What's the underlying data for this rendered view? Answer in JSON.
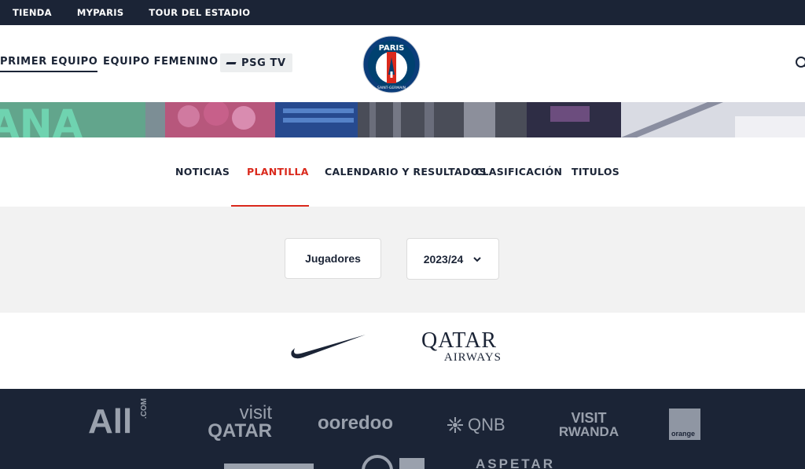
{
  "topbar": {
    "links": [
      "TIENDA",
      "MYPARIS",
      "TOUR DEL ESTADIO"
    ]
  },
  "mainnav": {
    "primer_equipo": "PRIMER EQUIPO",
    "equipo_femenino": "EQUIPO FEMENINO",
    "psg_tv": "PSG TV",
    "crest": {
      "top_text": "PARIS",
      "bottom_text": "SAINT-GERMAIN"
    }
  },
  "banner": {
    "text": "ANA"
  },
  "subnav": {
    "tabs": [
      "NOTICIAS",
      "PLANTILLA",
      "CALENDARIO Y RESULTADOS",
      "CLASIFICACIÓN",
      "TITULOS"
    ],
    "active_index": 1
  },
  "filters": {
    "jugadores": "Jugadores",
    "season": "2023/24"
  },
  "main_sponsors": {
    "qatar_top": "QATAR",
    "qatar_bottom": "AIRWAYS"
  },
  "footer_sponsors": {
    "all": "All",
    "all_com": ".COM",
    "visit_qatar_1": "visit",
    "visit_qatar_2": "QATAR",
    "ooredoo": "ooredoo",
    "qnb": "QNB",
    "visit_rwanda_1": "VISIT",
    "visit_rwanda_2": "RWANDA",
    "orange": "orange",
    "aspetar": "ASPETAR"
  },
  "colors": {
    "navy": "#1b2436",
    "red": "#da291c",
    "light_gray": "#f2f2f2",
    "sponsor_gray": "#9aa1ad"
  }
}
